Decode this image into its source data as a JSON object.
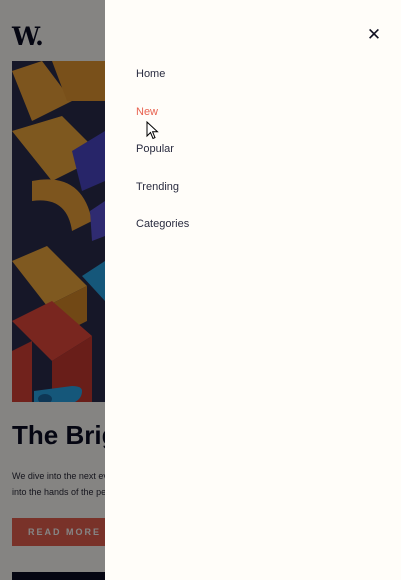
{
  "site": {
    "logo": "W."
  },
  "article": {
    "headline": "The Brig",
    "excerpt_line1": "We dive into the next ev",
    "excerpt_line2": "into the hands of the pe",
    "read_more_label": "READ MORE"
  },
  "drawer": {
    "close_icon": "close-icon",
    "close_glyph": "✕",
    "items": [
      {
        "label": "Home",
        "active": false
      },
      {
        "label": "New",
        "active": true
      },
      {
        "label": "Popular",
        "active": false
      },
      {
        "label": "Trending",
        "active": false
      },
      {
        "label": "Categories",
        "active": false
      }
    ]
  },
  "colors": {
    "accent": "#e8614f",
    "dark": "#0b0c24",
    "drawer_bg": "#fffdf9"
  }
}
